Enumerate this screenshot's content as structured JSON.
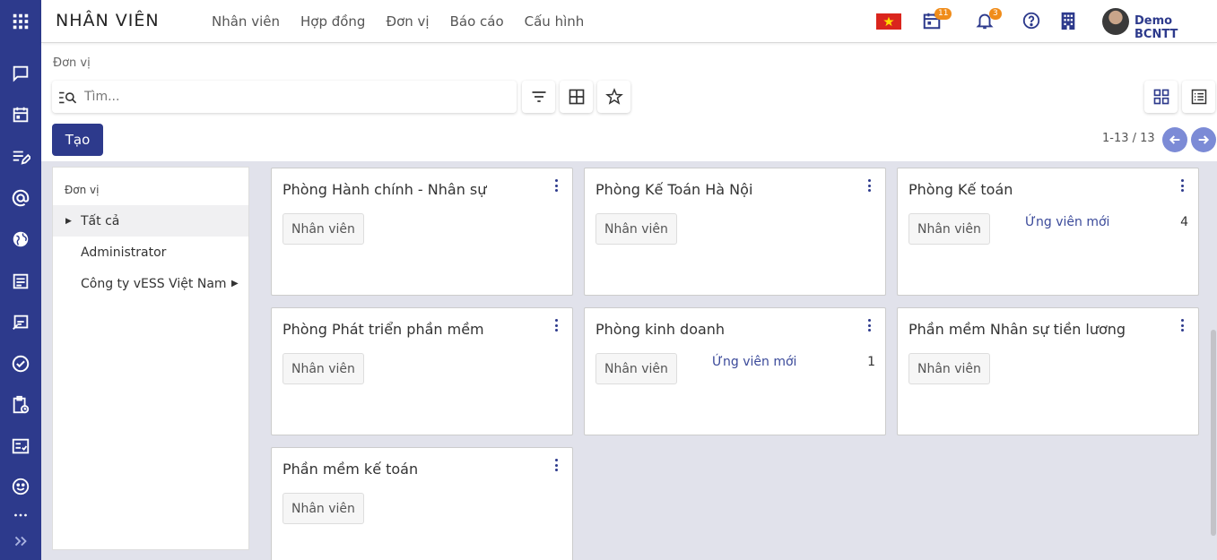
{
  "app_title": "NHÂN VIÊN",
  "top_menu": [
    "Nhân viên",
    "Hợp đồng",
    "Đơn vị",
    "Báo cáo",
    "Cấu hình"
  ],
  "top_bar": {
    "calendar_badge": "11",
    "notification_badge": "3",
    "user_name": "Demo BCNTT",
    "flag_color": "#da251d"
  },
  "breadcrumb": "Đơn vị",
  "search": {
    "placeholder": "Tìm...",
    "value": ""
  },
  "create_label": "Tạo",
  "pager": "1-13 / 13",
  "left_panel": {
    "title": "Đơn vị",
    "items": [
      "Tất cả",
      "Administrator",
      "Công ty vESS Việt Nam"
    ]
  },
  "cards": [
    {
      "title": "Phòng Hành chính - Nhân sự",
      "button": "Nhân viên",
      "candidate_label": "",
      "candidate_count": ""
    },
    {
      "title": "Phòng Kế Toán Hà Nội",
      "button": "Nhân viên",
      "candidate_label": "",
      "candidate_count": ""
    },
    {
      "title": "Phòng Kế toán",
      "button": "Nhân viên",
      "candidate_label": "Ứng viên mới",
      "candidate_count": "4"
    },
    {
      "title": "Phòng Phát triển phần mềm",
      "button": "Nhân viên",
      "candidate_label": "",
      "candidate_count": ""
    },
    {
      "title": "Phòng kinh doanh",
      "button": "Nhân viên",
      "candidate_label": "Ứng viên mới",
      "candidate_count": "1"
    },
    {
      "title": "Phần mềm Nhân sự tiền lương",
      "button": "Nhân viên",
      "candidate_label": "",
      "candidate_count": ""
    },
    {
      "title": "Phần mềm kế toán",
      "button": "Nhân viên",
      "candidate_label": "",
      "candidate_count": ""
    }
  ],
  "colors": {
    "brand": "#2d3a8c",
    "badge": "#f08c1a",
    "pager_button": "#7c8bd6",
    "background": "#e1e2eb"
  }
}
